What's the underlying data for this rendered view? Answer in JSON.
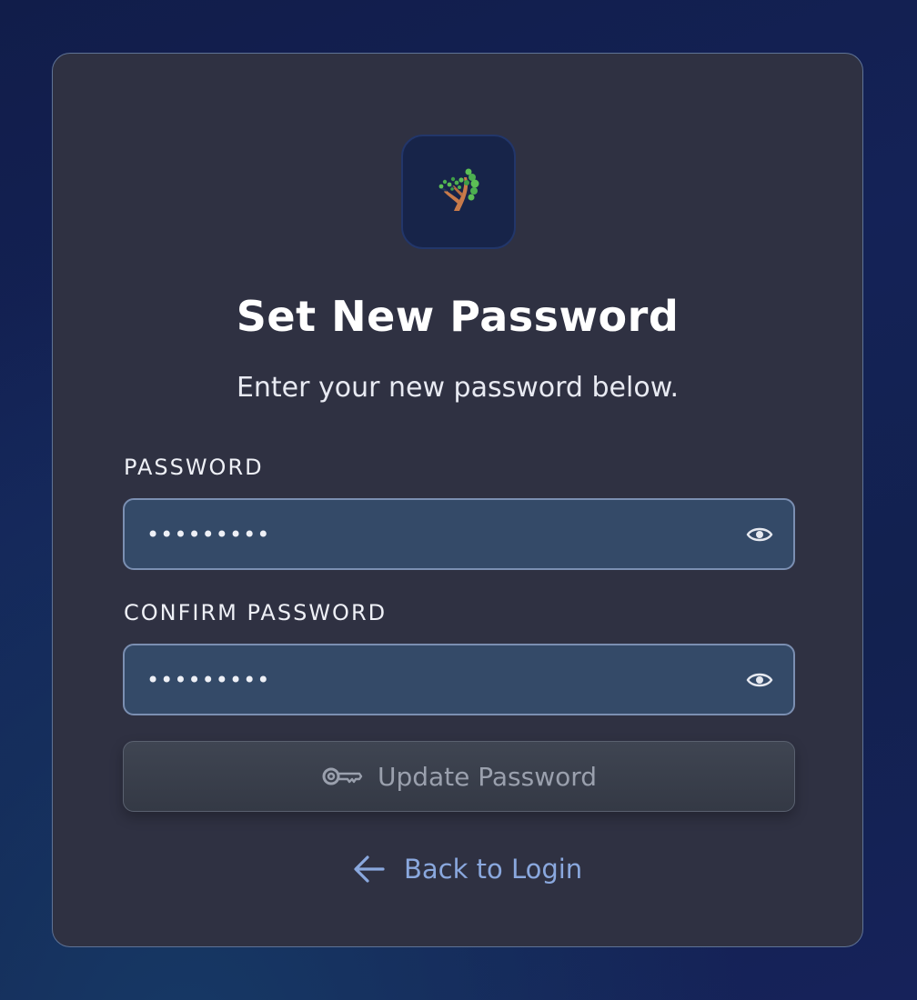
{
  "logo": {
    "icon": "tree-logo-icon"
  },
  "heading": {
    "title": "Set New Password",
    "subtitle": "Enter your new password below."
  },
  "form": {
    "password": {
      "label": "PASSWORD",
      "value": "•••••••••",
      "toggle_icon": "eye-icon"
    },
    "confirm_password": {
      "label": "CONFIRM PASSWORD",
      "value": "•••••••••",
      "toggle_icon": "eye-icon"
    },
    "submit": {
      "label": "Update Password",
      "icon": "key-icon",
      "state": "disabled"
    }
  },
  "footer": {
    "back_label": "Back to Login",
    "back_icon": "arrow-left-icon"
  },
  "colors": {
    "card_bg": "#2f3142",
    "input_bg": "#344a68",
    "link": "#8aa8de",
    "logo_green": "#4caf50",
    "logo_trunk": "#c87a4a"
  }
}
